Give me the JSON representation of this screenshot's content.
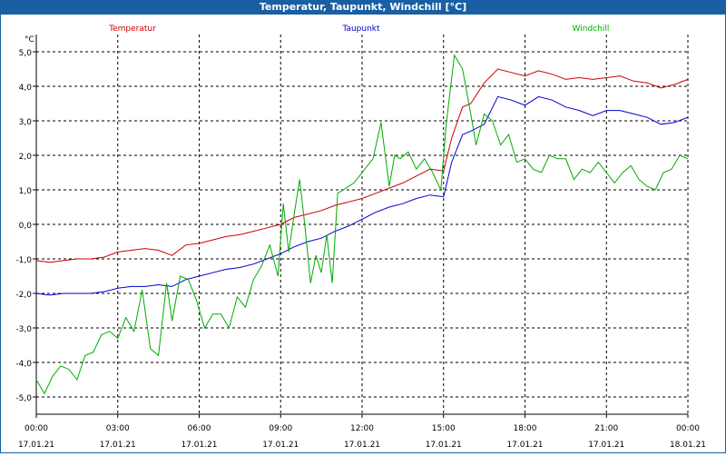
{
  "window": {
    "title": "Temperatur, Taupunkt, Windchill [°C]"
  },
  "colors": {
    "titlebar": "#1a5fa3",
    "Temperatur": "#cc0000",
    "Taupunkt": "#0000cc",
    "Windchill": "#00aa00"
  },
  "chart_data": {
    "type": "line",
    "title": "Temperatur, Taupunkt, Windchill [°C]",
    "ylabel": "°C",
    "ylim": [
      -5.5,
      5.5
    ],
    "y_ticks": [
      5.0,
      4.0,
      3.0,
      2.0,
      1.0,
      0.0,
      -1.0,
      -2.0,
      -3.0,
      -4.0,
      -5.0
    ],
    "y_tick_labels": [
      "5,0",
      "4,0",
      "3,0",
      "2,0",
      "1,0",
      "0,0",
      "-1,0",
      "-2,0",
      "-3,0",
      "-4,0",
      "-5,0"
    ],
    "xlim": [
      0,
      24
    ],
    "x_ticks": [
      {
        "x": 0,
        "time": "00:00",
        "date": "17.01.21"
      },
      {
        "x": 3,
        "time": "03:00",
        "date": "17.01.21"
      },
      {
        "x": 6,
        "time": "06:00",
        "date": "17.01.21"
      },
      {
        "x": 9,
        "time": "09:00",
        "date": "17.01.21"
      },
      {
        "x": 12,
        "time": "12:00",
        "date": "17.01.21"
      },
      {
        "x": 15,
        "time": "15:00",
        "date": "17.01.21"
      },
      {
        "x": 18,
        "time": "18:00",
        "date": "17.01.21"
      },
      {
        "x": 21,
        "time": "21:00",
        "date": "17.01.21"
      },
      {
        "x": 24,
        "time": "00:00",
        "date": "18.01.21"
      }
    ],
    "grid": true,
    "legend": "top",
    "series": [
      {
        "name": "Temperatur",
        "color": "#cc0000",
        "x": [
          0,
          0.5,
          1,
          1.5,
          2,
          2.5,
          3,
          3.5,
          4,
          4.5,
          5,
          5.5,
          6,
          6.5,
          7,
          7.5,
          8,
          8.5,
          9,
          9.5,
          10,
          10.5,
          11,
          11.5,
          12,
          12.5,
          13,
          13.5,
          14,
          14.5,
          15,
          15.3,
          15.7,
          16,
          16.5,
          17,
          17.5,
          18,
          18.5,
          19,
          19.5,
          20,
          20.5,
          21,
          21.5,
          22,
          22.5,
          23,
          23.5,
          24
        ],
        "values": [
          -1.05,
          -1.1,
          -1.05,
          -1.0,
          -1.0,
          -0.95,
          -0.8,
          -0.75,
          -0.7,
          -0.75,
          -0.9,
          -0.6,
          -0.55,
          -0.45,
          -0.35,
          -0.3,
          -0.2,
          -0.1,
          0.0,
          0.2,
          0.3,
          0.4,
          0.55,
          0.65,
          0.75,
          0.9,
          1.05,
          1.2,
          1.4,
          1.6,
          1.55,
          2.5,
          3.4,
          3.5,
          4.1,
          4.5,
          4.4,
          4.3,
          4.45,
          4.35,
          4.2,
          4.25,
          4.2,
          4.25,
          4.3,
          4.15,
          4.1,
          3.95,
          4.05,
          4.2
        ]
      },
      {
        "name": "Taupunkt",
        "color": "#0000cc",
        "x": [
          0,
          0.5,
          1,
          1.5,
          2,
          2.5,
          3,
          3.5,
          4,
          4.5,
          5,
          5.5,
          6,
          6.5,
          7,
          7.5,
          8,
          8.5,
          9,
          9.5,
          10,
          10.5,
          11,
          11.5,
          12,
          12.5,
          13,
          13.5,
          14,
          14.5,
          15,
          15.3,
          15.7,
          16,
          16.5,
          17,
          17.5,
          18,
          18.5,
          19,
          19.5,
          20,
          20.5,
          21,
          21.5,
          22,
          22.5,
          23,
          23.5,
          24
        ],
        "values": [
          -2.0,
          -2.05,
          -2.0,
          -2.0,
          -2.0,
          -1.95,
          -1.85,
          -1.8,
          -1.8,
          -1.75,
          -1.8,
          -1.6,
          -1.5,
          -1.4,
          -1.3,
          -1.25,
          -1.15,
          -1.0,
          -0.85,
          -0.65,
          -0.5,
          -0.4,
          -0.2,
          -0.05,
          0.15,
          0.35,
          0.5,
          0.6,
          0.75,
          0.85,
          0.8,
          1.8,
          2.6,
          2.7,
          2.9,
          3.7,
          3.6,
          3.45,
          3.7,
          3.6,
          3.4,
          3.3,
          3.15,
          3.3,
          3.3,
          3.2,
          3.1,
          2.9,
          2.95,
          3.1
        ]
      },
      {
        "name": "Windchill",
        "color": "#00aa00",
        "x": [
          0,
          0.3,
          0.6,
          0.9,
          1.2,
          1.5,
          1.8,
          2.1,
          2.4,
          2.7,
          3.0,
          3.3,
          3.6,
          3.9,
          4.2,
          4.5,
          4.8,
          5.0,
          5.3,
          5.6,
          5.9,
          6.2,
          6.5,
          6.8,
          7.1,
          7.4,
          7.7,
          8.0,
          8.3,
          8.6,
          8.9,
          9.1,
          9.3,
          9.5,
          9.7,
          9.9,
          10.1,
          10.3,
          10.5,
          10.7,
          10.9,
          11.1,
          11.3,
          11.5,
          11.7,
          11.9,
          12.1,
          12.4,
          12.7,
          13.0,
          13.2,
          13.4,
          13.7,
          14.0,
          14.3,
          14.6,
          14.9,
          15.1,
          15.4,
          15.7,
          16.0,
          16.2,
          16.5,
          16.8,
          17.1,
          17.4,
          17.7,
          18.0,
          18.3,
          18.6,
          18.9,
          19.2,
          19.5,
          19.8,
          20.1,
          20.4,
          20.7,
          21.0,
          21.3,
          21.6,
          21.9,
          22.2,
          22.5,
          22.8,
          23.1,
          23.4,
          23.7,
          24.0
        ],
        "values": [
          -4.5,
          -4.9,
          -4.4,
          -4.1,
          -4.2,
          -4.5,
          -3.8,
          -3.7,
          -3.2,
          -3.1,
          -3.3,
          -2.7,
          -3.1,
          -1.9,
          -3.6,
          -3.8,
          -1.7,
          -2.8,
          -1.5,
          -1.6,
          -2.2,
          -3.0,
          -2.6,
          -2.6,
          -3.0,
          -2.1,
          -2.4,
          -1.6,
          -1.2,
          -0.6,
          -1.5,
          0.6,
          -0.8,
          0.3,
          1.3,
          -0.1,
          -1.7,
          -0.9,
          -1.4,
          -0.3,
          -1.7,
          0.9,
          1.0,
          1.1,
          1.2,
          1.4,
          1.6,
          1.9,
          2.95,
          1.1,
          2.0,
          1.9,
          2.1,
          1.6,
          1.9,
          1.5,
          1.0,
          2.9,
          4.9,
          4.5,
          3.2,
          2.3,
          3.2,
          3.0,
          2.3,
          2.6,
          1.8,
          1.9,
          1.6,
          1.5,
          2.0,
          1.9,
          1.9,
          1.3,
          1.6,
          1.5,
          1.8,
          1.5,
          1.2,
          1.5,
          1.7,
          1.3,
          1.1,
          1.0,
          1.5,
          1.6,
          2.0,
          1.9
        ]
      }
    ]
  }
}
